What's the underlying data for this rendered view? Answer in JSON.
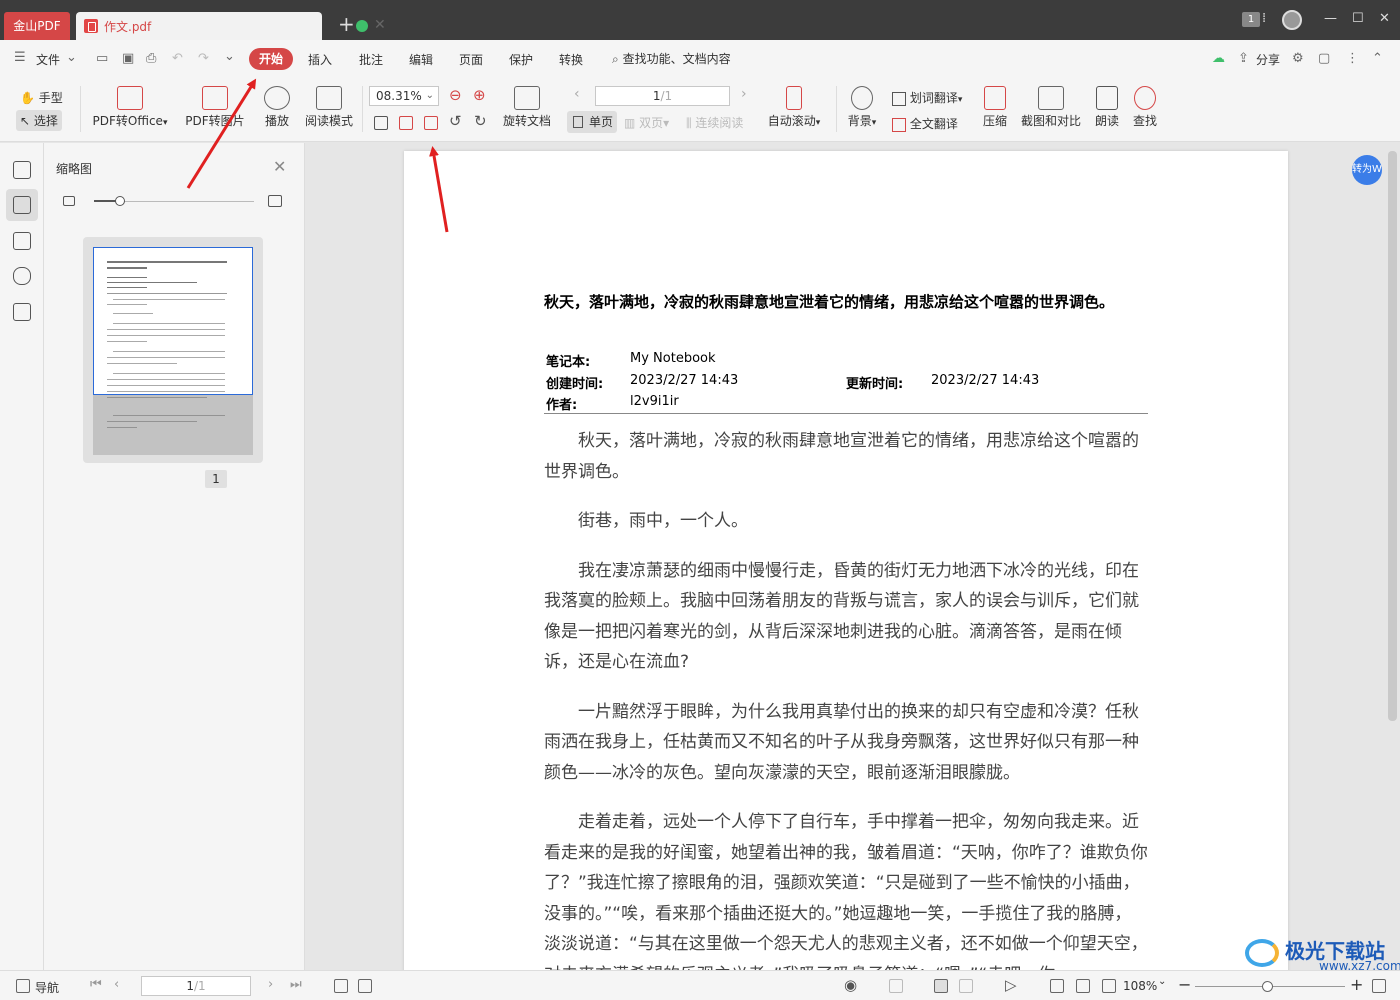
{
  "titlebar": {
    "app_tab": "金山PDF",
    "doc_tab": "作文.pdf",
    "new_tab": "+",
    "page_badge": "1"
  },
  "menubar": {
    "file": "文件",
    "tabs": [
      "开始",
      "插入",
      "批注",
      "编辑",
      "页面",
      "保护",
      "转换"
    ],
    "search": "查找功能、文档内容",
    "share": "分享"
  },
  "toolbar": {
    "hand": "手型",
    "select": "选择",
    "pdf_to_office": "PDF转Office",
    "pdf_to_image": "PDF转图片",
    "play": "播放",
    "read_mode": "阅读模式",
    "zoom_value": "08.31%",
    "rotate_doc": "旋转文档",
    "page_value": "1",
    "page_total": "/1",
    "single_page": "单页",
    "double_page": "双页",
    "continuous": "连续阅读",
    "auto_scroll": "自动滚动",
    "background": "背景",
    "word_translate": "划词翻译",
    "full_translate": "全文翻译",
    "compress": "压缩",
    "screenshot_compare": "截图和对比",
    "read_aloud": "朗读",
    "find": "查找"
  },
  "thumbnail_panel": {
    "title": "缩略图",
    "page_label": "1"
  },
  "document": {
    "title": "秋天，落叶满地，冷寂的秋雨肆意地宣泄着它的情绪，用悲凉给这个喧嚣的世界调色。",
    "notebook_label": "笔记本:",
    "notebook_value": "My Notebook",
    "created_label": "创建时间:",
    "created_value": "2023/2/27 14:43",
    "updated_label": "更新时间:",
    "updated_value": "2023/2/27 14:43",
    "author_label": "作者:",
    "author_value": "l2v9i1ir",
    "paragraphs": [
      "秋天，落叶满地，冷寂的秋雨肆意地宣泄着它的情绪，用悲凉给这个喧嚣的世界调色。",
      "街巷，雨中，一个人。",
      "我在凄凉萧瑟的细雨中慢慢行走，昏黄的街灯无力地洒下冰冷的光线，印在我落寞的脸颊上。我脑中回荡着朋友的背叛与谎言，家人的误会与训斥，它们就像是一把把闪着寒光的剑，从背后深深地刺进我的心脏。滴滴答答，是雨在倾诉，还是心在流血?",
      "一片黯然浮于眼眸，为什么我用真挚付出的换来的却只有空虚和冷漠？任秋雨洒在我身上，任枯黄而又不知名的叶子从我身旁飘落，这世界好似只有那一种颜色——冰冷的灰色。望向灰濛濛的天空，眼前逐渐泪眼朦胧。",
      "走着走着，远处一个人停下了自行车，手中撑着一把伞，匆匆向我走来。近看走来的是我的好闺蜜，她望着出神的我，皱着眉道：“天呐，你咋了？谁欺负你了？”我连忙擦了擦眼角的泪，强颜欢笑道：“只是碰到了一些不愉快的小插曲，没事的。”“唉，看来那个插曲还挺大的。”她逗趣地一笑，一手揽住了我的胳膊，淡淡说道：“与其在这里做一个怨天尤人的悲观主义者，还不如做一个仰望天空，对未来充满希望的乐观主义者。”我吸了吸鼻子答道：“嗯。”“走吧，你"
    ],
    "convert_badge": "转为W"
  },
  "watermark": {
    "name": "极光下载站",
    "url": "www.xz7.com"
  },
  "statusbar": {
    "nav": "导航",
    "page": "1",
    "page_total": "/1",
    "zoom": "108%"
  },
  "colors": {
    "accent": "#d54747",
    "titlebar": "#3c3c3c",
    "toolbar_bg": "#f5f5f5",
    "annotation_arrow": "#e02020"
  }
}
